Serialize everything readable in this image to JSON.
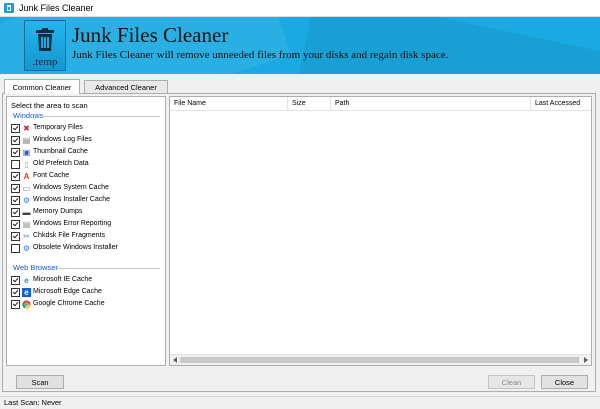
{
  "window": {
    "title": "Junk Files Cleaner"
  },
  "banner": {
    "title": "Junk Files Cleaner",
    "subtitle": "Junk Files Cleaner will remove unneeded files from your disks and regain disk space.",
    "logo_label": ".temp",
    "logo_icon": "trash-bin-icon"
  },
  "tabs": [
    {
      "label": "Common Cleaner",
      "active": true
    },
    {
      "label": "Advanced Cleaner",
      "active": false
    }
  ],
  "left_panel": {
    "heading": "Select the area to scan",
    "groups": [
      {
        "label": "Windows",
        "items": [
          {
            "label": "Temporary Files",
            "checked": true,
            "icon": "temp-file-icon"
          },
          {
            "label": "Windows Log Files",
            "checked": true,
            "icon": "log-file-icon"
          },
          {
            "label": "Thumbnail Cache",
            "checked": true,
            "icon": "thumbnail-icon"
          },
          {
            "label": "Old Prefetch Data",
            "checked": false,
            "icon": "prefetch-icon"
          },
          {
            "label": "Font Cache",
            "checked": true,
            "icon": "font-icon"
          },
          {
            "label": "Windows System Cache",
            "checked": true,
            "icon": "system-cache-icon"
          },
          {
            "label": "Windows Installer Cache",
            "checked": true,
            "icon": "installer-icon"
          },
          {
            "label": "Memory Dumps",
            "checked": true,
            "icon": "memory-icon"
          },
          {
            "label": "Windows Error Reporting",
            "checked": true,
            "icon": "error-report-icon"
          },
          {
            "label": "Chkdsk File Fragments",
            "checked": true,
            "icon": "chkdsk-icon"
          },
          {
            "label": "Obsolete Windows Installer",
            "checked": false,
            "icon": "obsolete-installer-icon"
          }
        ]
      },
      {
        "label": "Web Browser",
        "items": [
          {
            "label": "Microsoft IE Cache",
            "checked": true,
            "icon": "ie-icon"
          },
          {
            "label": "Microsoft Edge Cache",
            "checked": true,
            "icon": "edge-icon"
          },
          {
            "label": "Google Chrome Cache",
            "checked": true,
            "icon": "chrome-icon"
          }
        ]
      }
    ]
  },
  "results_table": {
    "columns": [
      "File Name",
      "Size",
      "Path",
      "Last Accessed"
    ],
    "rows": []
  },
  "buttons": {
    "scan": "Scan",
    "clean": "Clean",
    "close": "Close"
  },
  "status": {
    "text": "Last Scan: Never"
  },
  "colors": {
    "banner": "#1aa9e0",
    "group_label": "#1d57c9"
  }
}
